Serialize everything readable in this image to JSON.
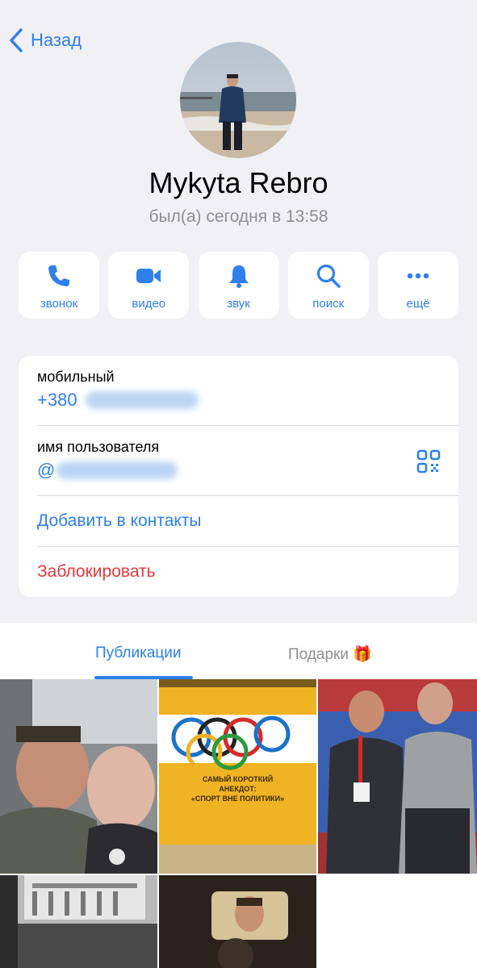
{
  "header": {
    "back_label": "Назад"
  },
  "profile": {
    "name": "Mykyta Rebro",
    "status": "был(а) сегодня в 13:58"
  },
  "actions": [
    {
      "label": "звонок",
      "icon": "phone-icon"
    },
    {
      "label": "видео",
      "icon": "video-icon"
    },
    {
      "label": "звук",
      "icon": "bell-icon"
    },
    {
      "label": "поиск",
      "icon": "search-icon"
    },
    {
      "label": "ещё",
      "icon": "more-icon"
    }
  ],
  "info": {
    "mobile_title": "мобильный",
    "mobile_value": "+380",
    "username_title": "имя пользователя",
    "username_value": "@",
    "add_contact": "Добавить в контакты",
    "block": "Заблокировать"
  },
  "tabs": {
    "publications": "Публикации",
    "gifts": "Подарки 🎁"
  },
  "posts": {
    "p2_text_line1": "САМЫЙ КОРОТКИЙ",
    "p2_text_line2": "АНЕКДОТ:",
    "p2_text_line3": "«СПОРТ ВНЕ ПОЛИТИКИ»"
  },
  "colors": {
    "accent": "#2f80ee",
    "danger": "#e5383b",
    "background": "#f0f0f5"
  }
}
